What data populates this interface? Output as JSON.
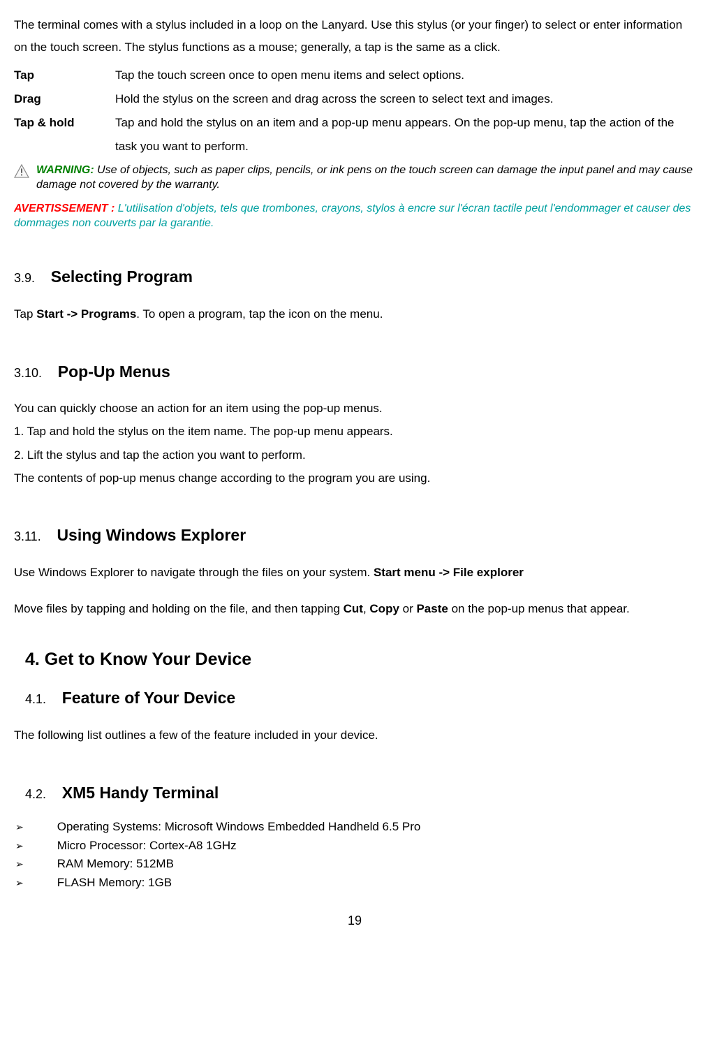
{
  "intro": "The terminal comes with a stylus included in a loop on the Lanyard. Use this stylus (or your finger) to select or enter information on the touch screen. The stylus functions as a mouse; generally, a tap is the same as a click.",
  "defs": {
    "tap": {
      "term": "Tap",
      "desc": "Tap the touch screen once to open menu items and select options."
    },
    "drag": {
      "term": "Drag",
      "desc": "Hold the stylus on the screen and drag across the screen to select text and images."
    },
    "taphold": {
      "term": "Tap & hold",
      "desc": "Tap and hold the stylus on an item and a pop-up menu appears. On the pop-up menu, tap the action of the task you want to perform."
    }
  },
  "warning": {
    "label": "WARNING:",
    "text": " Use of objects, such as paper clips, pencils, or ink pens on the touch screen can damage the input panel and may cause damage not covered by the warranty."
  },
  "avert": {
    "label": "AVERTISSEMENT :",
    "text": " L'utilisation d'objets, tels que trombones, crayons, stylos à encre sur l'écran tactile peut l'endommager et causer des dommages non couverts par la garantie."
  },
  "s39": {
    "num": "3.9.",
    "title": "Selecting Program",
    "body_pre": "Tap ",
    "body_bold": "Start -> Programs",
    "body_post": ". To open a program, tap the icon on the menu."
  },
  "s310": {
    "num": "3.10.",
    "title": "Pop-Up Menus",
    "l1": "You can quickly choose an action for an item using the pop-up menus.",
    "l2": "1. Tap and hold the stylus on the item name. The pop-up menu appears.",
    "l3": "2. Lift the stylus and tap the action you want to perform.",
    "l4": "The contents of pop-up menus change according to the program you are using."
  },
  "s311": {
    "num": "3.11.",
    "title": "Using Windows Explorer",
    "p1_pre": "Use Windows Explorer to navigate through the files on your system. ",
    "p1_bold": "Start menu -> File explorer",
    "p2_a": "Move files by tapping and holding on the file, and then tapping ",
    "p2_b1": "Cut",
    "p2_c1": ", ",
    "p2_b2": "Copy",
    "p2_c2": " or ",
    "p2_b3": "Paste",
    "p2_c3": " on the pop-up menus that appear."
  },
  "chapter4": "4. Get to Know Your Device",
  "s41": {
    "num": "4.1.",
    "title": "Feature of Your Device",
    "body": "The following list outlines a few of the feature included in your device."
  },
  "s42": {
    "num": "4.2.",
    "title": "XM5 Handy Terminal",
    "items": {
      "0": "Operating Systems: Microsoft Windows Embedded Handheld 6.5 Pro",
      "1": "Micro Processor: Cortex-A8 1GHz",
      "2": "RAM Memory: 512MB",
      "3": "FLASH Memory: 1GB"
    }
  },
  "page_number": "19"
}
